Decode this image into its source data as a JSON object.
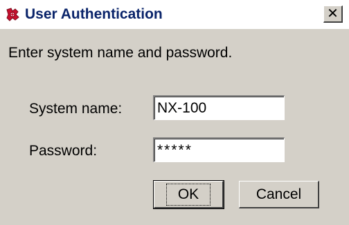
{
  "window": {
    "title": "User Authentication",
    "app_icon": "app-logo-icon",
    "close_symbol": "✕",
    "close_icon": "close-icon"
  },
  "prompt": "Enter system name and password.",
  "fields": {
    "system_name_label": "System name:",
    "system_name_value": "NX-100",
    "password_label": "Password:",
    "password_value": "*****"
  },
  "buttons": {
    "ok_label": "OK",
    "cancel_label": "Cancel"
  },
  "colors": {
    "dialog_bg": "#d4d0c8",
    "title_text": "#0a246a"
  }
}
